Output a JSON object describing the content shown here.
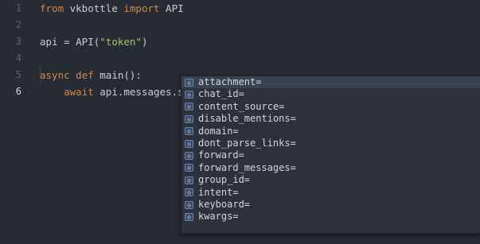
{
  "editor": {
    "active_line": 6,
    "lines": [
      {
        "n": "1",
        "tokens": [
          {
            "t": "from",
            "c": "kw"
          },
          {
            "t": " vkbottle ",
            "c": ""
          },
          {
            "t": "import",
            "c": "kw"
          },
          {
            "t": " API",
            "c": ""
          }
        ]
      },
      {
        "n": "2",
        "tokens": []
      },
      {
        "n": "3",
        "tokens": [
          {
            "t": "api = API(",
            "c": ""
          },
          {
            "t": "\"token\"",
            "c": "str"
          },
          {
            "t": ")",
            "c": ""
          }
        ]
      },
      {
        "n": "4",
        "tokens": []
      },
      {
        "n": "5",
        "tokens": [
          {
            "t": "async",
            "c": "kw"
          },
          {
            "t": " ",
            "c": ""
          },
          {
            "t": "def",
            "c": "kw"
          },
          {
            "t": " main():",
            "c": ""
          }
        ]
      },
      {
        "n": "6",
        "tokens": [
          {
            "t": "    ",
            "c": ""
          },
          {
            "t": "await",
            "c": "kw"
          },
          {
            "t": " api.messages.send",
            "c": ""
          },
          {
            "t": "(",
            "c": "cursor"
          },
          {
            "t": ")",
            "c": "cursor"
          }
        ]
      }
    ]
  },
  "autocomplete": {
    "icon": "parameter-icon",
    "icon_glyph": "⊙",
    "selected_index": 0,
    "items": [
      "attachment=",
      "chat_id=",
      "content_source=",
      "disable_mentions=",
      "domain=",
      "dont_parse_links=",
      "forward=",
      "forward_messages=",
      "group_id=",
      "intent=",
      "keyboard=",
      "kwargs="
    ]
  },
  "colors": {
    "background": "#272b33",
    "keyword": "#d08a4e",
    "string": "#a4c469",
    "popup_background": "#2c313a",
    "selection": "#3a4150"
  }
}
